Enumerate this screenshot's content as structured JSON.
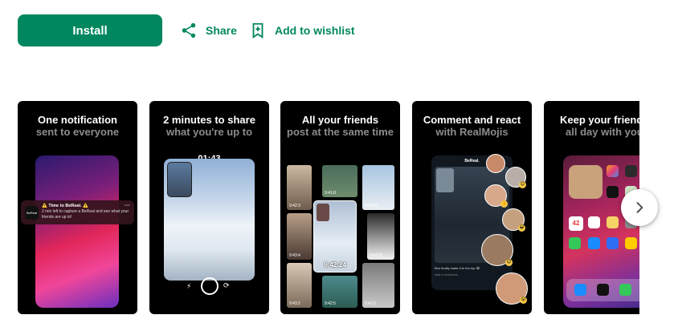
{
  "actions": {
    "install_label": "Install",
    "share_label": "Share",
    "wishlist_label": "Add to wishlist",
    "share_icon": "share-icon",
    "wishlist_icon": "bookmark-add-icon"
  },
  "colors": {
    "accent": "#01875f",
    "card_background": "#000000",
    "subtitle": "#8c8c8c"
  },
  "screenshots": [
    {
      "title": "One notification",
      "subtitle": "sent to everyone",
      "notification": {
        "app": "BeReal",
        "title": "⚠️ Time to BeReal. ⚠️",
        "body": "2 min left to capture a BeReal and see what your friends are up to!",
        "time": "now"
      }
    },
    {
      "title": "2 minutes to share",
      "subtitle": "what you're up to",
      "timer": "01:43"
    },
    {
      "title": "All your friends",
      "subtitle": "post at the same time",
      "center_time": "9:42:24",
      "tile_times": [
        "9:42:3",
        "9:41:8",
        "9:42:03",
        "9:43:4",
        "9:42:11",
        "9:43:2",
        "9:42:5",
        "9:41:5",
        "9:43:0",
        "9:42:7",
        "9:41:2",
        "9:42:1"
      ]
    },
    {
      "title": "Comment and react",
      "subtitle": "with RealMojis",
      "brand": "BeReal.",
      "caption": "Ben finally made it to the top 😂",
      "sub_caption": "Add a comment..."
    },
    {
      "title": "Keep your friend",
      "subtitle": "all day with you",
      "clock": "42",
      "apps": [
        "Photos",
        "Camera",
        "BeReal",
        "Maps",
        "Clock",
        "Notes",
        "FaceTime",
        "App Store",
        "Settings",
        "Shop"
      ],
      "dock": [
        "Safari",
        "BeReal",
        "Messages"
      ]
    }
  ],
  "nav": {
    "next_icon": "chevron-right-icon"
  }
}
